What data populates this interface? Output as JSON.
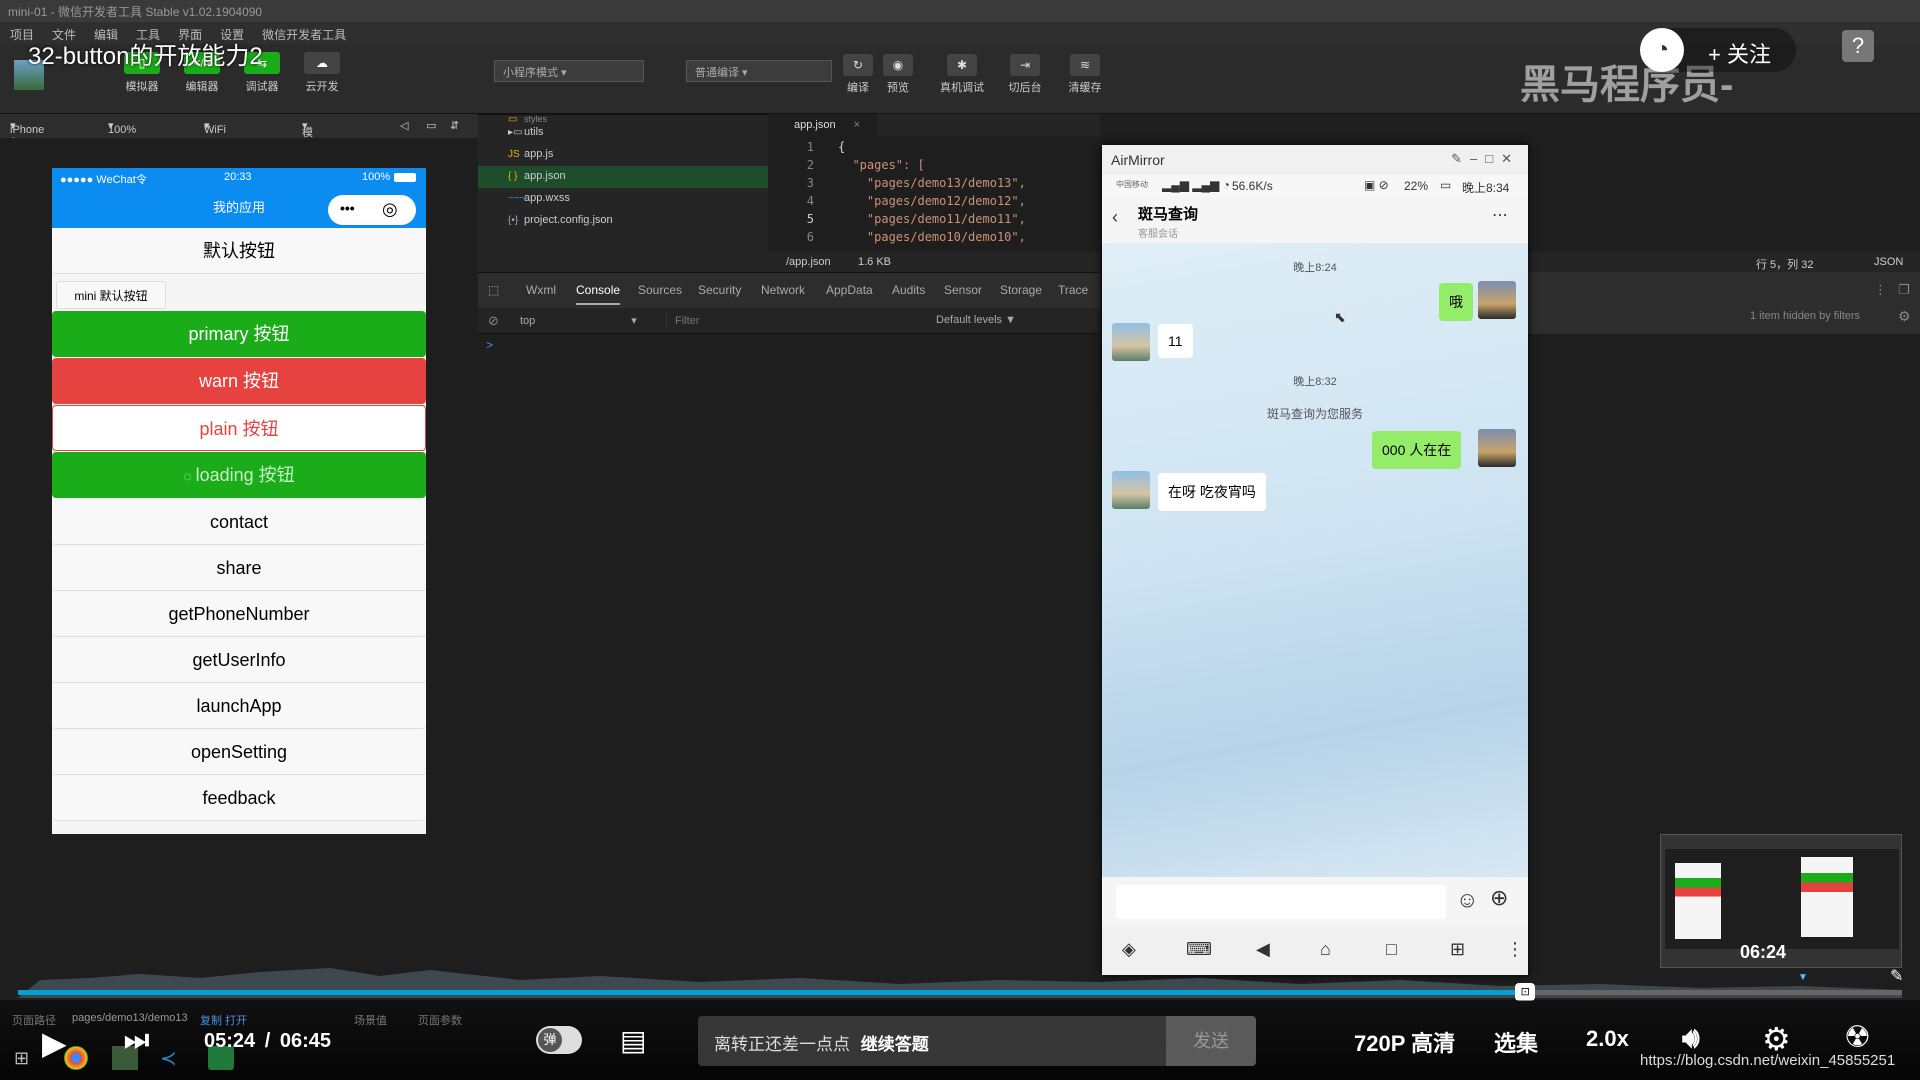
{
  "window": {
    "title": "mini-01 - 微信开发者工具 Stable v1.02.1904090",
    "menu": [
      "项目",
      "文件",
      "编辑",
      "工具",
      "界面",
      "设置",
      "微信开发者工具"
    ]
  },
  "video": {
    "title": "32-button的开放能力2",
    "watermark": "黑马程序员-",
    "follow_label": "+ 关注"
  },
  "toolbar": {
    "buttons": [
      "模拟器",
      "编辑器",
      "调试器",
      "云开发"
    ],
    "mode_select": "小程序模式",
    "compile_select": "普通编译",
    "actions": [
      "编译",
      "预览",
      "真机调试",
      "切后台",
      "清缓存"
    ]
  },
  "device_bar": {
    "device": "iPhone 6",
    "zoom": "100%",
    "network": "WiFi",
    "operation": "模拟操作"
  },
  "simulator": {
    "status_left": "●●●●● WeChat令",
    "status_time": "20:33",
    "status_right": "100%",
    "nav_title": "我的应用",
    "capsule_dots": "•••",
    "capsule_circle": "◎",
    "buttons": {
      "default": "默认按钮",
      "mini": "mini 默认按钮",
      "primary": "primary 按钮",
      "warn": "warn 按钮",
      "plain": "plain 按钮",
      "loading": "loading 按钮",
      "contact": "contact",
      "share": "share",
      "getPhoneNumber": "getPhoneNumber",
      "getUserInfo": "getUserInfo",
      "launchApp": "launchApp",
      "openSetting": "openSetting",
      "feedback": "feedback"
    },
    "colors": {
      "nav": "#0a8cf0",
      "primary": "#1aad19",
      "warn": "#e64340"
    }
  },
  "filetree": {
    "items": [
      {
        "icon": "folder",
        "name": "styles"
      },
      {
        "icon": "folder",
        "name": "utils"
      },
      {
        "icon": "JS",
        "name": "app.js"
      },
      {
        "icon": "{ }",
        "name": "app.json"
      },
      {
        "icon": "~~~",
        "name": "app.wxss"
      },
      {
        "icon": "{•}",
        "name": "project.config.json"
      }
    ]
  },
  "editor": {
    "tab": "app.json",
    "lines": [
      {
        "n": "1",
        "text": "{"
      },
      {
        "n": "2",
        "text": "  \"pages\": ["
      },
      {
        "n": "3",
        "text": "    \"pages/demo13/demo13\","
      },
      {
        "n": "4",
        "text": "    \"pages/demo12/demo12\","
      },
      {
        "n": "5",
        "text": "    \"pages/demo11/demo11\","
      },
      {
        "n": "6",
        "text": "    \"pages/demo10/demo10\","
      }
    ],
    "status_path": "/app.json",
    "status_size": "1.6 KB",
    "status_pos": "行 5，列 32",
    "status_lang": "JSON"
  },
  "devtools": {
    "tabs": [
      "Wxml",
      "Console",
      "Sources",
      "Security",
      "Network",
      "AppData",
      "Audits",
      "Sensor",
      "Storage",
      "Trace"
    ],
    "active_tab": "Console",
    "context": "top",
    "filter_placeholder": "Filter",
    "levels": "Default levels ▼",
    "hidden_info": "1 item hidden by filters",
    "prompt": ">"
  },
  "airmirror": {
    "title": "AirMirror",
    "status_carrier": "中国移动",
    "status_speed": "56.6K/s",
    "status_battery": "22%",
    "status_time": "晚上8:34",
    "chat_title": "斑马查询",
    "chat_subtitle": "客服会话",
    "messages": {
      "time1": "晚上8:24",
      "me1": "哦",
      "them1": "11",
      "time2": "晚上8:32",
      "system": "斑马查询为您服务",
      "me2": "000 人在在",
      "them2": "在呀 吃夜宵吗"
    }
  },
  "ide_status": {
    "left": "页面路径",
    "path": "pages/demo13/demo13",
    "copy": "复制 打开",
    "scene": "场景值",
    "params": "页面参数"
  },
  "player": {
    "current_time": "05:24",
    "separator": "/",
    "total_time": "06:45",
    "progress": 0.8,
    "preview_time": "06:24",
    "danmaku_placeholder": "离转正还差一点点",
    "danmaku_action": "继续答题",
    "send": "发送",
    "quality": "720P 高清",
    "episodes": "选集",
    "speed": "2.0x",
    "danmaku_toggle": "弹",
    "url": "https://blog.csdn.net/weixin_45855251"
  }
}
